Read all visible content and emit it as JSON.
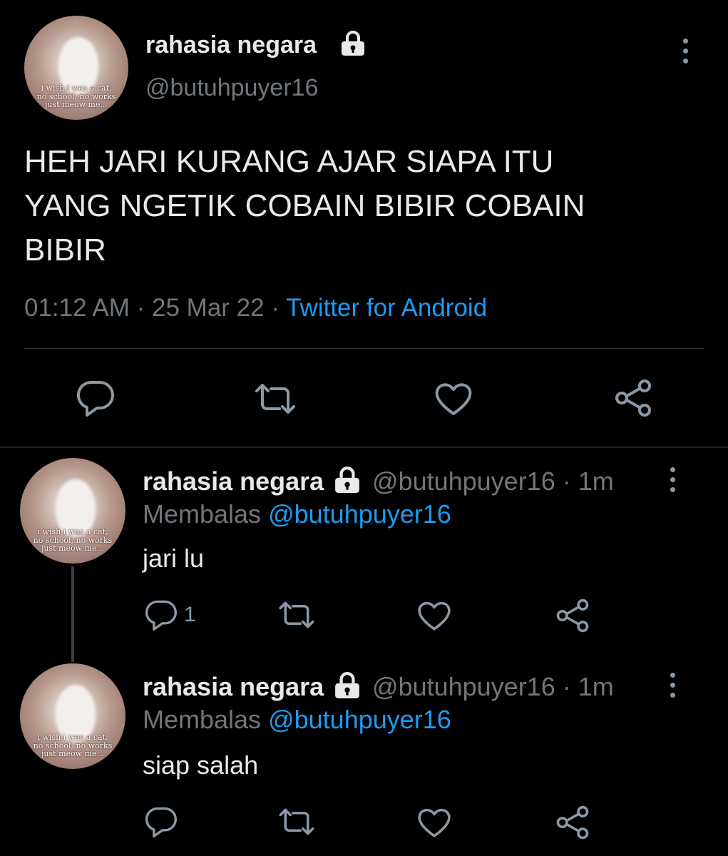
{
  "main_tweet": {
    "display_name": "rahasia negara",
    "handle": "@butuhpuyer16",
    "text_lines": [
      "HEH JARI KURANG AJAR SIAPA ITU",
      "YANG NGETIK COBAIN BIBIR COBAIN",
      "BIBIR"
    ],
    "time": "01:12 AM",
    "date": "25 Mar 22",
    "separator": "·",
    "source": "Twitter for Android",
    "avatar_caption": [
      "i wish i was a cat,",
      "no school, no works",
      "just meow me..."
    ]
  },
  "replies": [
    {
      "display_name": "rahasia negara",
      "handle": "@butuhpuyer16",
      "time_ago": "1m",
      "separator": "·",
      "replying_prefix": "Membalas",
      "replying_to": "@butuhpuyer16",
      "text": "jari lu",
      "reply_count": "1",
      "avatar_caption": [
        "i wish i was a cat,",
        "no school, no works",
        "just meow me..."
      ]
    },
    {
      "display_name": "rahasia negara",
      "handle": "@butuhpuyer16",
      "time_ago": "1m",
      "separator": "·",
      "replying_prefix": "Membalas",
      "replying_to": "@butuhpuyer16",
      "text": "siap salah",
      "reply_count": "",
      "avatar_caption": [
        "i wish i was a cat,",
        "no school, no works",
        "just meow me..."
      ]
    }
  ],
  "icons": {
    "lock": "lock-icon",
    "more": "more-vertical-icon",
    "reply": "reply-icon",
    "retweet": "retweet-icon",
    "like": "heart-icon",
    "share": "share-icon"
  },
  "colors": {
    "background": "#000000",
    "text": "#e7e9ea",
    "muted": "#71767b",
    "link": "#1d9bf0",
    "icon": "#8b98a5",
    "divider": "#2f3336"
  }
}
